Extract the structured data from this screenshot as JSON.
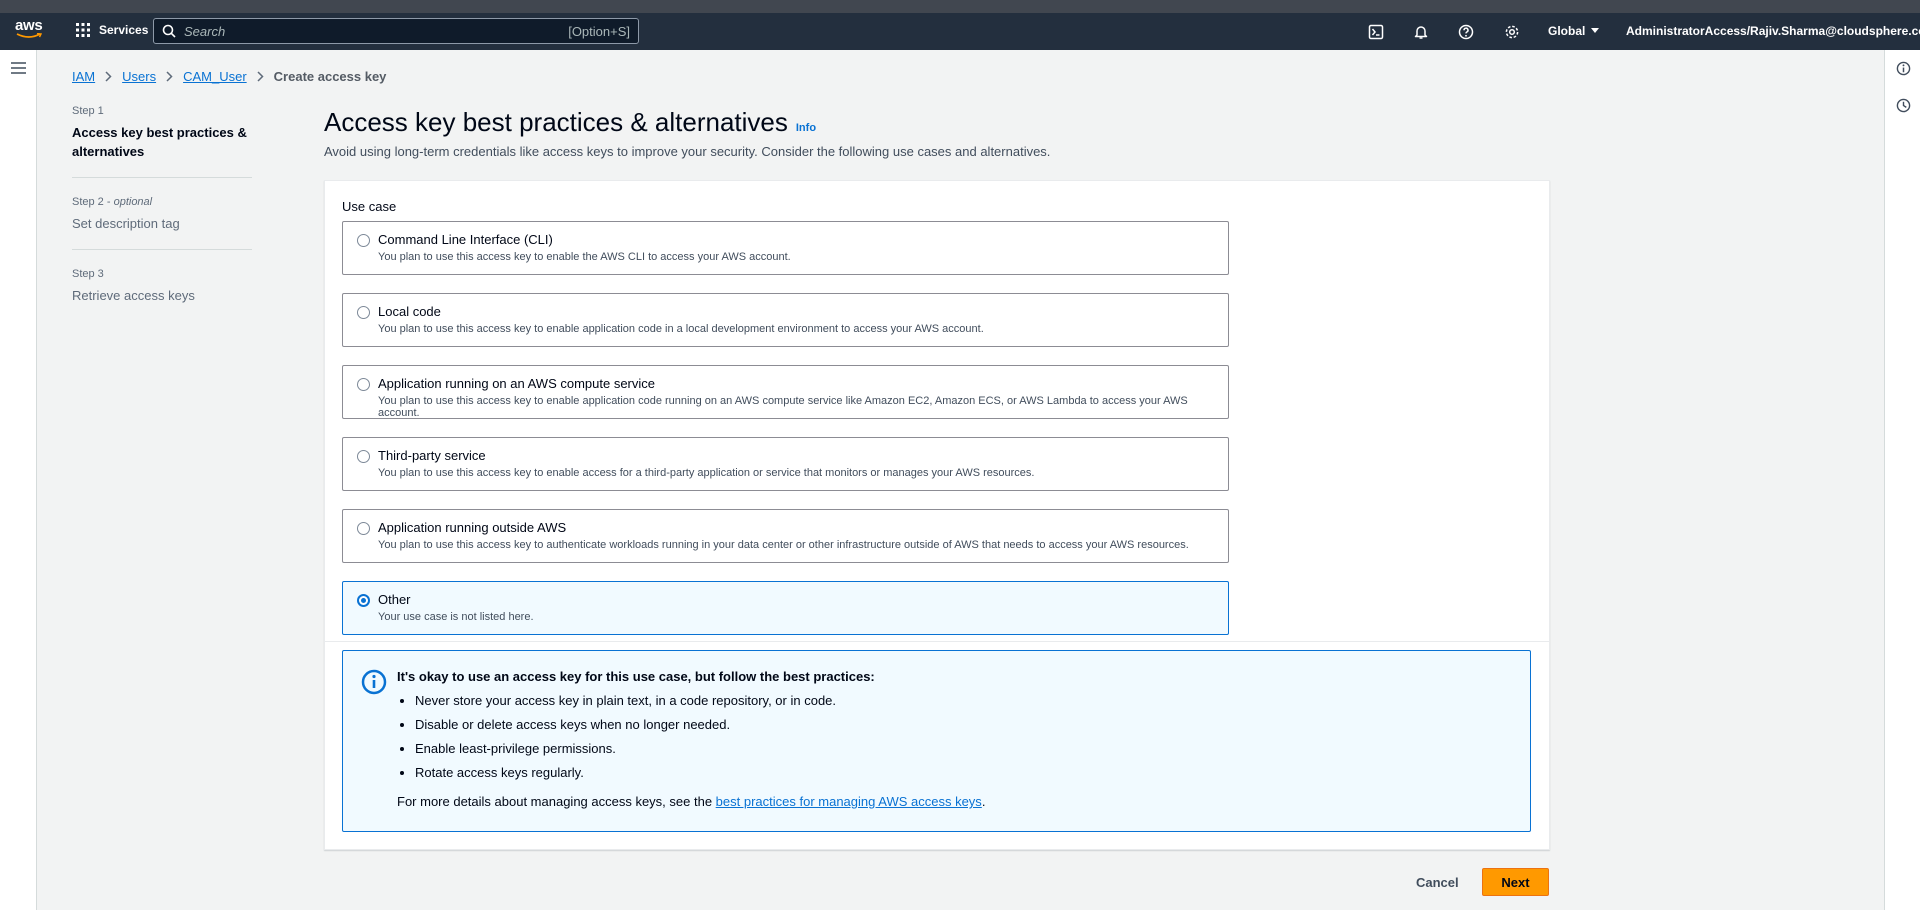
{
  "nav": {
    "logo_text": "aws",
    "services_label": "Services",
    "search_placeholder": "Search",
    "search_shortcut": "[Option+S]",
    "region_label": "Global",
    "account_label": "AdministratorAccess/Rajiv.Sharma@cloudsphere.com",
    "colors": {
      "bar": "#232f3e",
      "accent": "#ff9900"
    }
  },
  "breadcrumb": {
    "items": [
      "IAM",
      "Users",
      "CAM_User"
    ],
    "current": "Create access key"
  },
  "steps": [
    {
      "num": "Step 1",
      "optional": "",
      "label": "Access key best practices & alternatives",
      "active": true
    },
    {
      "num": "Step 2 - ",
      "optional": "optional",
      "label": "Set description tag",
      "active": false
    },
    {
      "num": "Step 3",
      "optional": "",
      "label": "Retrieve access keys",
      "active": false
    }
  ],
  "header": {
    "title": "Access key best practices & alternatives",
    "info": "Info",
    "description": "Avoid using long-term credentials like access keys to improve your security. Consider the following use cases and alternatives."
  },
  "usecase": {
    "label": "Use case",
    "selected": 5,
    "options": [
      {
        "title": "Command Line Interface (CLI)",
        "desc": "You plan to use this access key to enable the AWS CLI to access your AWS account."
      },
      {
        "title": "Local code",
        "desc": "You plan to use this access key to enable application code in a local development environment to access your AWS account."
      },
      {
        "title": "Application running on an AWS compute service",
        "desc": "You plan to use this access key to enable application code running on an AWS compute service like Amazon EC2, Amazon ECS, or AWS Lambda to access your AWS account."
      },
      {
        "title": "Third-party service",
        "desc": "You plan to use this access key to enable access for a third-party application or service that monitors or manages your AWS resources."
      },
      {
        "title": "Application running outside AWS",
        "desc": "You plan to use this access key to authenticate workloads running in your data center or other infrastructure outside of AWS that needs to access your AWS resources."
      },
      {
        "title": "Other",
        "desc": "Your use case is not listed here."
      }
    ]
  },
  "alert": {
    "title": "It's okay to use an access key for this use case, but follow the best practices:",
    "bullets": [
      "Never store your access key in plain text, in a code repository, or in code.",
      "Disable or delete access keys when no longer needed.",
      "Enable least-privilege permissions.",
      "Rotate access keys regularly."
    ],
    "footer_prefix": "For more details about managing access keys, see the ",
    "footer_link": "best practices for managing AWS access keys",
    "footer_suffix": "."
  },
  "actions": {
    "cancel": "Cancel",
    "next": "Next"
  }
}
